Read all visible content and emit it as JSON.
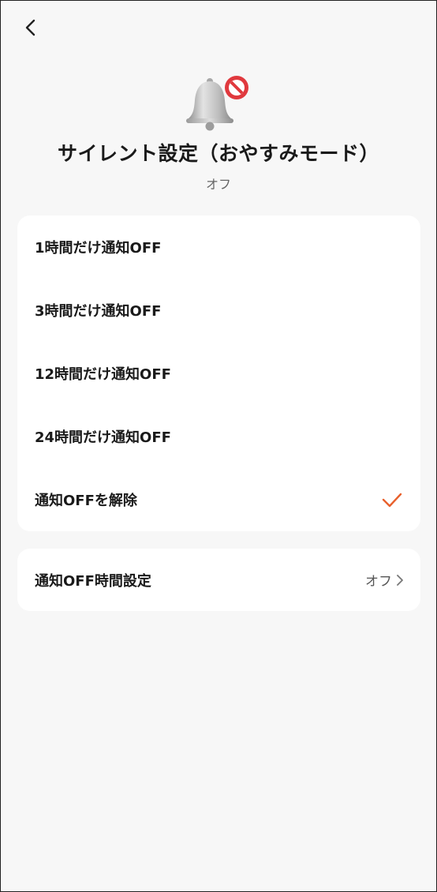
{
  "header": {
    "title": "サイレント設定（おやすみモード）",
    "status": "オフ"
  },
  "options": [
    {
      "label": "1時間だけ通知OFF",
      "selected": false
    },
    {
      "label": "3時間だけ通知OFF",
      "selected": false
    },
    {
      "label": "12時間だけ通知OFF",
      "selected": false
    },
    {
      "label": "24時間だけ通知OFF",
      "selected": false
    },
    {
      "label": "通知OFFを解除",
      "selected": true
    }
  ],
  "schedule": {
    "label": "通知OFF時間設定",
    "value": "オフ"
  },
  "icons": {
    "back": "chevron-left-icon",
    "hero": "bell-muted-icon",
    "selected": "checkmark-icon",
    "row_arrow": "chevron-right-icon"
  },
  "colors": {
    "background": "#f7f7f7",
    "card": "#ffffff",
    "accent": "#e8602c",
    "no_sign": "#e0393e"
  }
}
